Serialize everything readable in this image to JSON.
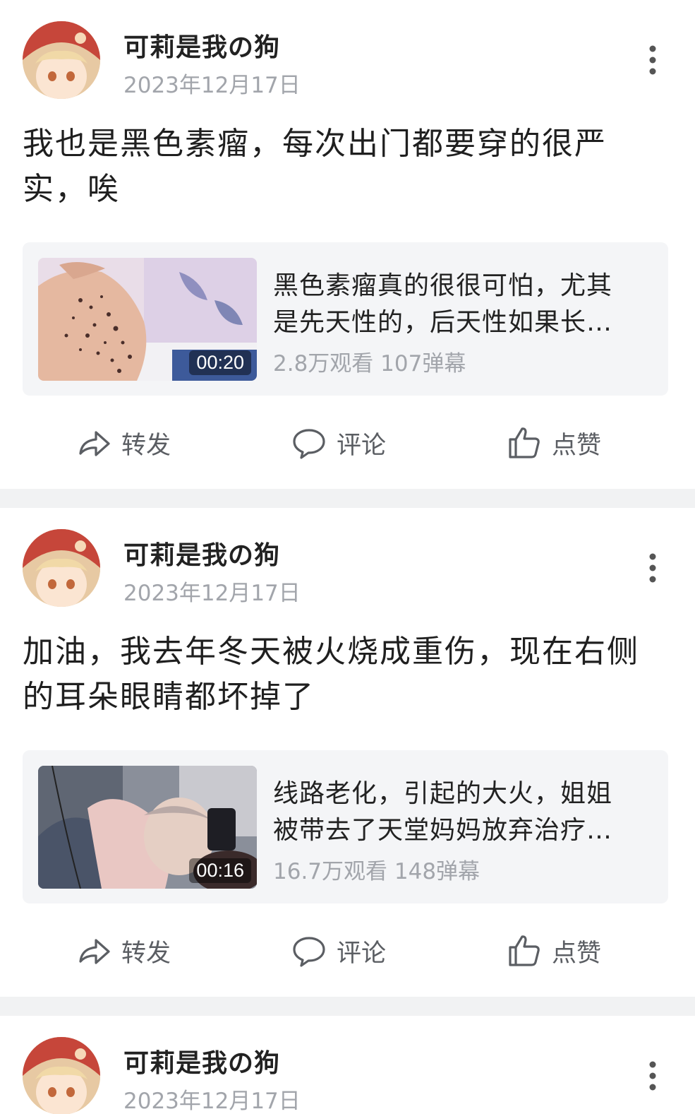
{
  "posts": [
    {
      "username": "可莉是我の狗",
      "date": "2023年12月17日",
      "text": "我也是黑色素瘤，每次出门都要穿的很严实，唉",
      "video": {
        "title": "黑色素瘤真的很很可怕，尤其是先天性的，后天性如果长…",
        "duration": "00:20",
        "stats": "2.8万观看 107弹幕"
      },
      "actions": {
        "share": "转发",
        "comment": "评论",
        "like": "点赞"
      }
    },
    {
      "username": "可莉是我の狗",
      "date": "2023年12月17日",
      "text": "加油，我去年冬天被火烧成重伤，现在右侧的耳朵眼睛都坏掉了",
      "video": {
        "title": "线路老化，引起的大火，姐姐被带去了天堂妈妈放弃治疗…",
        "duration": "00:16",
        "stats": "16.7万观看 148弹幕"
      },
      "actions": {
        "share": "转发",
        "comment": "评论",
        "like": "点赞"
      }
    },
    {
      "username": "可莉是我の狗",
      "date": "2023年12月17日"
    }
  ],
  "colors": {
    "page_background": "#ffffff",
    "divider": "#f1f2f3",
    "card_background": "#f4f5f7",
    "secondary_text": "#a2a5ab",
    "action_text": "#5b5e63"
  },
  "icons": [
    "more-vertical-icon",
    "share-icon",
    "comment-icon",
    "like-icon"
  ]
}
